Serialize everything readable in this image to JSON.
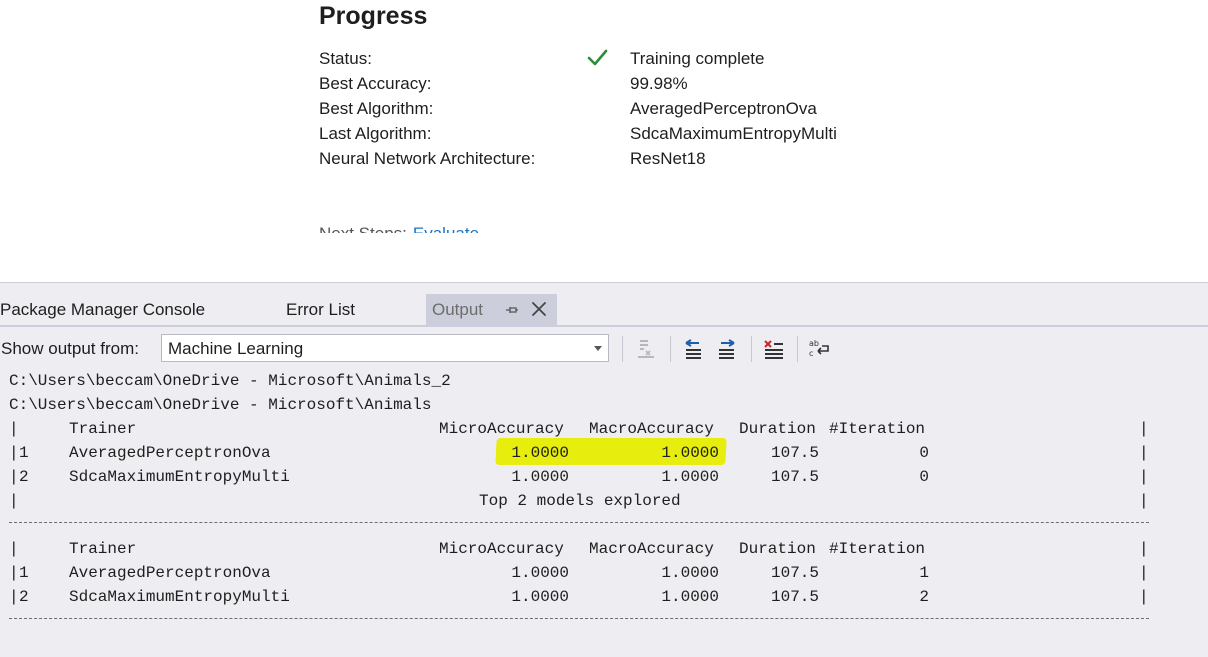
{
  "progress": {
    "title": "Progress",
    "rows": [
      {
        "label": "Status:",
        "value": "Training complete"
      },
      {
        "label": "Best Accuracy:",
        "value": "99.98%"
      },
      {
        "label": "Best Algorithm:",
        "value": "AveragedPerceptronOva"
      },
      {
        "label": "Last Algorithm:",
        "value": "SdcaMaximumEntropyMulti"
      },
      {
        "label": "Neural Network Architecture:",
        "value": "ResNet18"
      }
    ],
    "next_steps_label": "Next Steps:",
    "next_steps_link": "Evaluate"
  },
  "tabs": {
    "package_manager": "Package Manager Console",
    "error_list": "Error List",
    "output": "Output"
  },
  "toolbar": {
    "show_output_label": "Show output from:",
    "source_selected": "Machine Learning"
  },
  "console": {
    "paths": [
      "C:\\Users\\beccam\\OneDrive - Microsoft\\Animals_2",
      "C:\\Users\\beccam\\OneDrive - Microsoft\\Animals"
    ],
    "headers": {
      "trainer": "Trainer",
      "micro": "MicroAccuracy",
      "macro": "MacroAccuracy",
      "duration": "Duration",
      "iteration": "#Iteration"
    },
    "table1": [
      {
        "rank": "1",
        "trainer": "AveragedPerceptronOva",
        "micro": "1.0000",
        "macro": "1.0000",
        "duration": "107.5",
        "iteration": "0"
      },
      {
        "rank": "2",
        "trainer": "SdcaMaximumEntropyMulti",
        "micro": "1.0000",
        "macro": "1.0000",
        "duration": "107.5",
        "iteration": "0"
      }
    ],
    "summary": "Top 2 models explored",
    "table2": [
      {
        "rank": "1",
        "trainer": "AveragedPerceptronOva",
        "micro": "1.0000",
        "macro": "1.0000",
        "duration": "107.5",
        "iteration": "1"
      },
      {
        "rank": "2",
        "trainer": "SdcaMaximumEntropyMulti",
        "micro": "1.0000",
        "macro": "1.0000",
        "duration": "107.5",
        "iteration": "2"
      }
    ]
  },
  "colors": {
    "check_green": "#2e8b3a",
    "highlight_yellow": "#e6ec00",
    "link_blue": "#1a73c8",
    "panel_bg": "#eeeef2"
  }
}
